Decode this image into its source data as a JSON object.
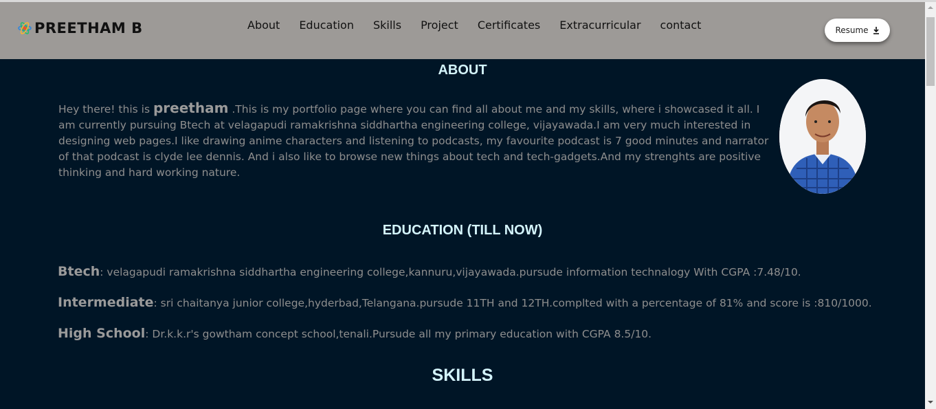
{
  "brand": {
    "name": "PREETHAM B",
    "logo_icon": "colorful-atom-logo-icon"
  },
  "nav": {
    "items": [
      "About",
      "Education",
      "Skills",
      "Project",
      "Certificates",
      "Extracurricular",
      "contact"
    ]
  },
  "resume_button": {
    "label": "Resume",
    "icon": "download-icon"
  },
  "about": {
    "heading": "ABOUT",
    "intro": "Hey there! this is ",
    "name": "preetham",
    "body": " .This is my portfolio page where you can find all about me and my skills, where i showcased it all. I am currently pursuing Btech at velagapudi ramakrishna siddhartha engineering college, vijayawada.I am very much interested in designing web pages.I like drawing anime characters and listening to podcasts, my favourite podcast is 7 good minutes and narrator of that podcast is clyde lee dennis. And i also like to browse new things about tech and tech-gadgets.And my strenghts are positive thinking and hard working nature."
  },
  "education": {
    "heading": "EDUCATION (TILL NOW)",
    "entries": [
      {
        "label": "Btech",
        "text": ": velagapudi ramakrishna siddhartha engineering college,kannuru,vijayawada.pursude information technalogy With CGPA :7.48/10."
      },
      {
        "label": "Intermediate",
        "text": ": sri chaitanya junior college,hyderbad,Telangana.pursude 11TH and 12TH.complted with a percentage of 81% and score is :810/1000."
      },
      {
        "label": "High School",
        "text": ": Dr.k.k.r's gowtham concept school,tenali.Pursude all my primary education with CGPA 8.5/10."
      }
    ]
  },
  "skills": {
    "heading": "SKILLS"
  },
  "colors": {
    "navbar_bg": "#9d9a97",
    "page_bg": "#001526",
    "heading": "#d4f4fb",
    "body_text": "#8e8e8e"
  }
}
